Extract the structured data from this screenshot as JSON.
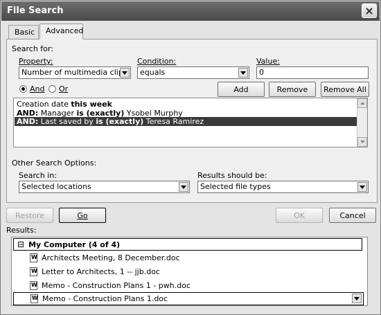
{
  "window": {
    "title": "File Search"
  },
  "tabs": [
    {
      "label": "Basic"
    },
    {
      "label": "Advanced"
    }
  ],
  "search_for": {
    "group_label": "Search for:",
    "property_label": "Property:",
    "property_value": "Number of multimedia clips",
    "condition_label": "Condition:",
    "condition_value": "equals",
    "value_label": "Value:",
    "value_value": "0",
    "and_label": "And",
    "or_label": "Or",
    "add_label": "Add",
    "remove_label": "Remove",
    "remove_all_label": "Remove All"
  },
  "criteria": [
    {
      "prefix": "",
      "text1": "Creation date ",
      "bold": "this week",
      "text2": ""
    },
    {
      "prefix": "AND:",
      "text1": " Manager ",
      "bold": "is (exactly)",
      "text2": " Ysobel Murphy"
    },
    {
      "prefix": "AND:",
      "text1": " Last saved by ",
      "bold": "is (exactly)",
      "text2": " Teresa Ramirez"
    }
  ],
  "other_options": {
    "group_label": "Other Search Options:",
    "search_in_label": "Search in:",
    "search_in_value": "Selected locations",
    "results_be_label": "Results should be:",
    "results_be_value": "Selected file types"
  },
  "actions": {
    "restore_label": "Restore",
    "go_label": "Go",
    "ok_label": "OK",
    "cancel_label": "Cancel"
  },
  "results": {
    "label": "Results:",
    "root": "My Computer  (4 of 4)",
    "expander": "⊟",
    "files": [
      "Architects Meeting, 8 December.doc",
      "Letter to Architects, 1 -- jjb.doc",
      "Memo - Construction Plans 1 - pwh.doc",
      "Memo - Construction Plans 1.doc"
    ]
  },
  "icons": {
    "close": "close-icon",
    "dropdown": "chevron-down-icon",
    "doc": "word-document-icon"
  }
}
